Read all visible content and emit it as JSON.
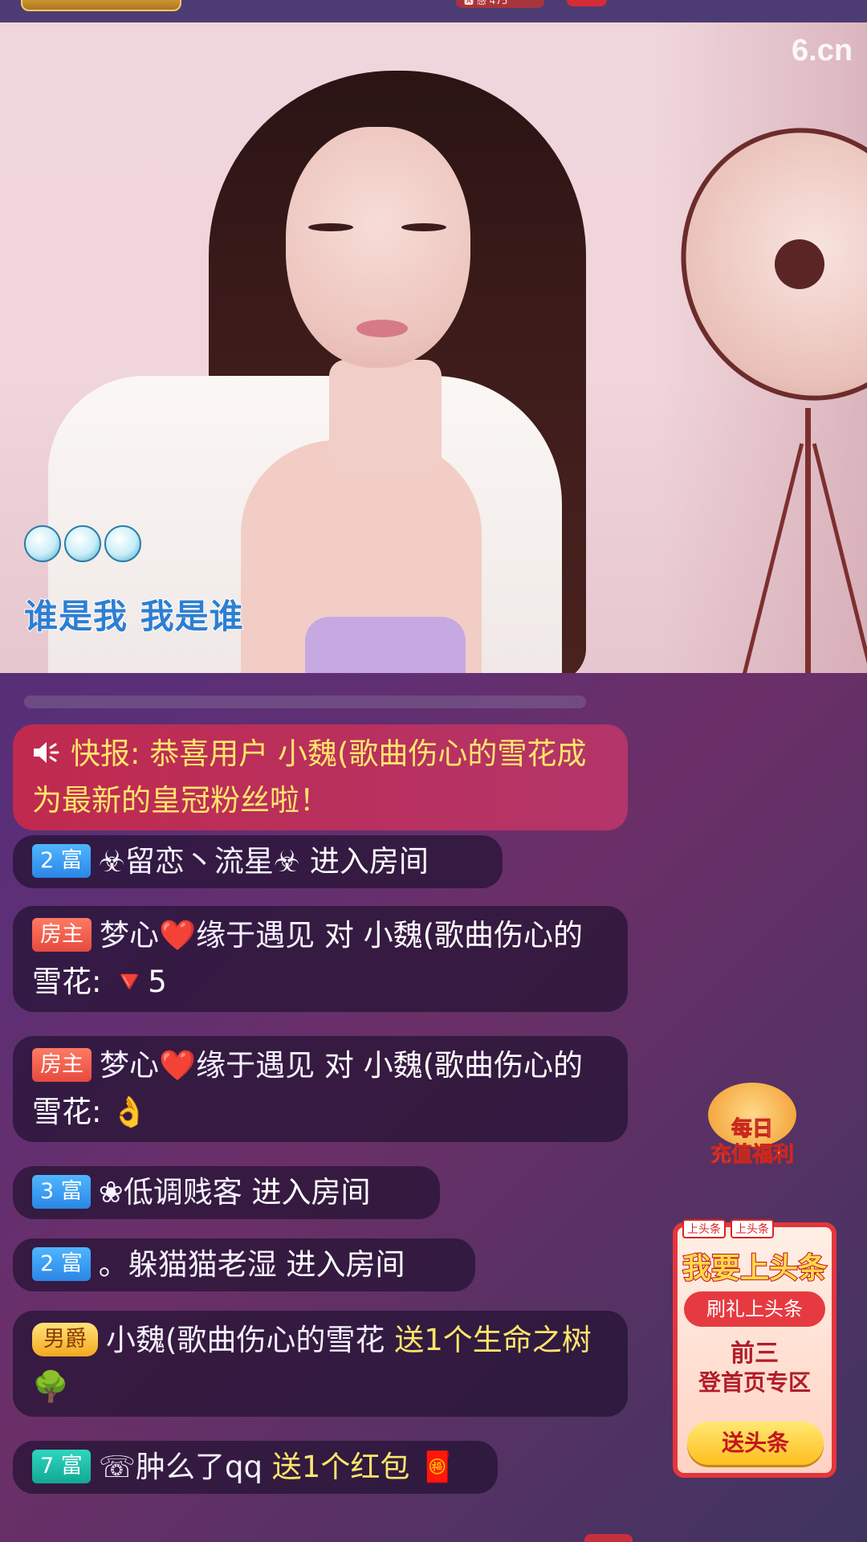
{
  "top_bar": {
    "pill_text": "🅰 感 475"
  },
  "video": {
    "watermark": "6.cn",
    "lyric": "谁是我  我是谁"
  },
  "chat": [
    {
      "type": "announcement",
      "prefix": "快报:",
      "text": "恭喜用户 小魏(歌曲伤心的雪花成为最新的皇冠粉丝啦！"
    },
    {
      "type": "enter",
      "badge": "2 富",
      "badge_color": "#2b86e6",
      "user": "☣留恋丶流星☣",
      "action": "进入房间"
    },
    {
      "type": "chat",
      "badge": "房主",
      "badge_color": "#e64a3f",
      "user": "梦心❤️缘于遇见",
      "mid": "对",
      "target": "小魏(歌曲伤心的雪花:",
      "emoji": "🔻5"
    },
    {
      "type": "chat",
      "badge": "房主",
      "badge_color": "#e64a3f",
      "user": "梦心❤️缘于遇见",
      "mid": "对",
      "target": "小魏(歌曲伤心的雪花:",
      "emoji": "👌"
    },
    {
      "type": "enter",
      "badge": "3 富",
      "badge_color": "#2b86e6",
      "user": "❀低调贱客",
      "action": "进入房间"
    },
    {
      "type": "enter",
      "badge": "2 富",
      "badge_color": "#2b86e6",
      "user": "。躲猫猫老湿",
      "action": "进入房间"
    },
    {
      "type": "gift",
      "badge": "男爵",
      "badge_color": "#f3a91e",
      "user": "小魏(歌曲伤心的雪花",
      "gift_text": "送1个生命之树",
      "emoji": "🌳"
    },
    {
      "type": "gift",
      "badge": "7 富",
      "badge_color": "#12a895",
      "user": "☏肿么了qq",
      "gift_text": "送1个红包",
      "emoji": "🧧"
    }
  ],
  "promo": {
    "label_line1": "每日",
    "label_line2": "充值福利"
  },
  "headline": {
    "tag1": "上头条",
    "tag2": "上头条",
    "title": "我要上头条",
    "pill": "刷礼上头条",
    "line1": "前三",
    "line2": "登首页专区",
    "button": "送头条"
  }
}
